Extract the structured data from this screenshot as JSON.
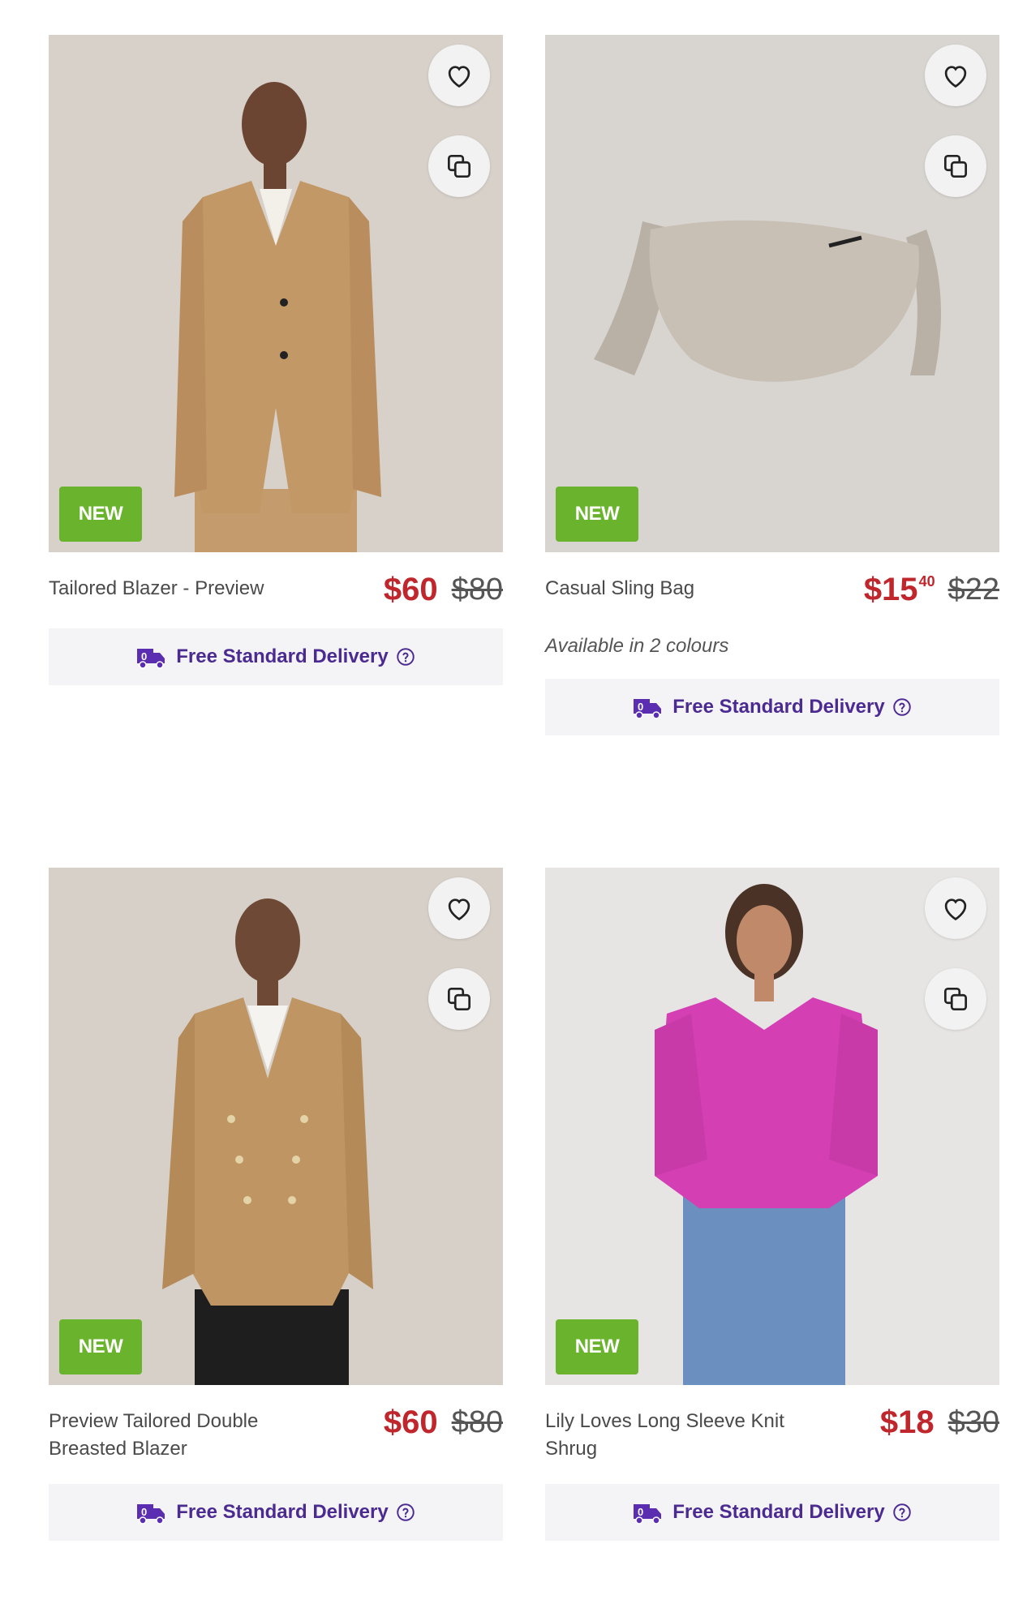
{
  "products": [
    {
      "name": "Tailored Blazer - Preview",
      "badge": "NEW",
      "price": "$60",
      "cents": "",
      "was_price": "$80",
      "delivery": "Free Standard Delivery"
    },
    {
      "name": "Casual Sling Bag",
      "badge": "NEW",
      "price": "$15",
      "cents": "40",
      "was_price": "$22",
      "colours": "Available in 2 colours",
      "delivery": "Free Standard Delivery"
    },
    {
      "name": "Preview Tailored Double Breasted Blazer",
      "badge": "NEW",
      "price": "$60",
      "cents": "",
      "was_price": "$80",
      "delivery": "Free Standard Delivery"
    },
    {
      "name": "Lily Loves Long Sleeve Knit Shrug",
      "badge": "NEW",
      "price": "$18",
      "cents": "",
      "was_price": "$30",
      "delivery": "Free Standard Delivery"
    }
  ],
  "icons": {
    "favourite": "heart-icon",
    "compare": "compare-icon",
    "delivery": "delivery-truck-icon",
    "help": "help-circle-icon"
  },
  "colors": {
    "badge": "#6ab42d",
    "price": "#c0272d",
    "delivery_text": "#4b2a91",
    "delivery_bg": "#f4f4f6"
  }
}
